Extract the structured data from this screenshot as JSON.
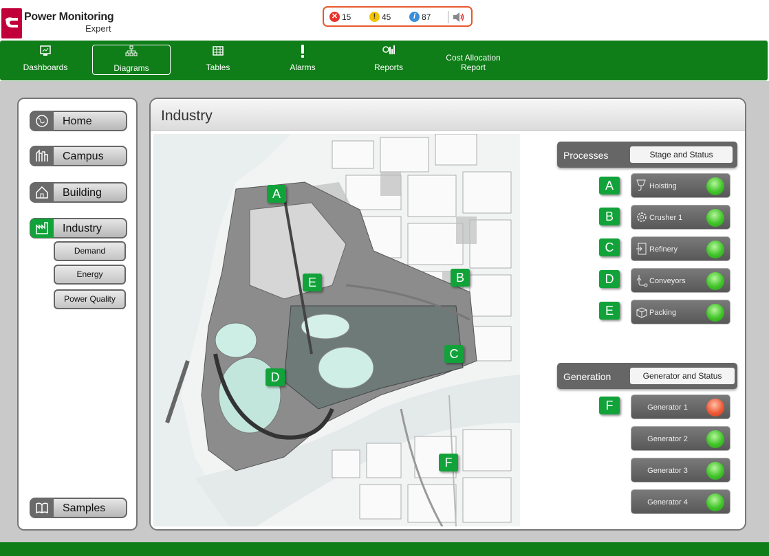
{
  "brand": {
    "line1": "Power Monitoring",
    "line2": "Expert"
  },
  "alarm_counts": {
    "error": "15",
    "warning": "45",
    "info": "87"
  },
  "nav": [
    {
      "label": "Dashboards",
      "icon": "dashboard-icon"
    },
    {
      "label": "Diagrams",
      "icon": "diagram-icon",
      "active": true
    },
    {
      "label": "Tables",
      "icon": "table-icon"
    },
    {
      "label": "Alarms",
      "icon": "alarm-exclamation-icon"
    },
    {
      "label": "Reports",
      "icon": "report-icon"
    },
    {
      "label": "Cost Allocation",
      "label2": "Report"
    }
  ],
  "sidebar": {
    "home": "Home",
    "campus": "Campus",
    "building": "Building",
    "industry": "Industry",
    "sub": [
      "Demand",
      "Energy",
      "Power Quality"
    ],
    "samples": "Samples"
  },
  "main": {
    "title": "Industry",
    "map_markers": [
      "A",
      "B",
      "C",
      "D",
      "E",
      "F"
    ],
    "processes": {
      "header": "Processes",
      "pill": "Stage and Status",
      "items": [
        {
          "marker": "A",
          "label": "Hoisting",
          "icon": "hoist-icon",
          "status": "ok"
        },
        {
          "marker": "B",
          "label": "Crusher 1",
          "icon": "gear-icon",
          "status": "ok"
        },
        {
          "marker": "C",
          "label": "Refinery",
          "icon": "refinery-icon",
          "status": "ok"
        },
        {
          "marker": "D",
          "label": "Conveyors",
          "icon": "conveyor-icon",
          "status": "ok"
        },
        {
          "marker": "E",
          "label": "Packing",
          "icon": "box-icon",
          "status": "ok"
        }
      ]
    },
    "generation": {
      "header": "Generation",
      "pill": "Generator and Status",
      "marker": "F",
      "items": [
        {
          "label": "Generator 1",
          "status": "alarm"
        },
        {
          "label": "Generator 2",
          "status": "ok"
        },
        {
          "label": "Generator 3",
          "status": "ok"
        },
        {
          "label": "Generator 4",
          "status": "ok"
        }
      ]
    }
  },
  "colors": {
    "nav_green": "#0f7d18",
    "marker_green": "#11a33a",
    "status_ok": "#40c429",
    "status_alarm": "#ee5a37",
    "brand_red": "#c1003b"
  }
}
